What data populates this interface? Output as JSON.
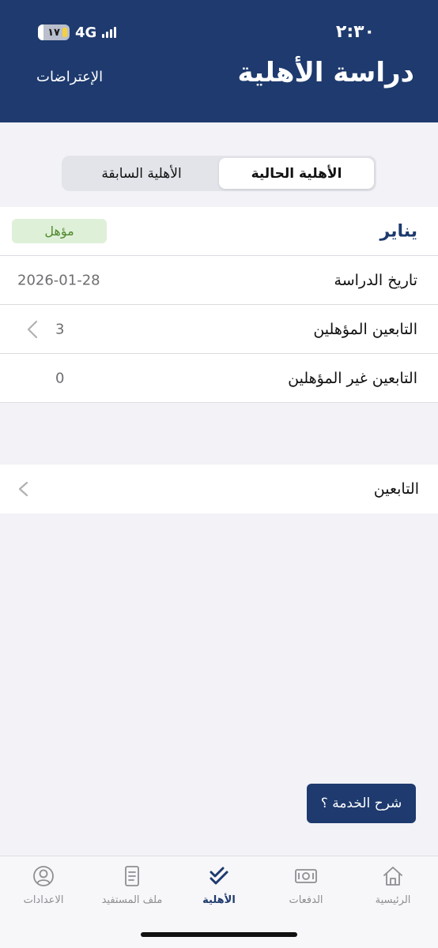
{
  "status_bar": {
    "time": "٢:٣٠",
    "network": "4G",
    "battery_label": "١٧",
    "battery_level": 0.17
  },
  "header": {
    "title": "دراسة الأهلية",
    "objections_link": "الإعتراضات"
  },
  "segmented": {
    "current": "الأهلية الحالية",
    "previous": "الأهلية السابقة"
  },
  "eligibility": {
    "month": "يناير",
    "status_badge": "مؤهل",
    "rows": [
      {
        "label": "تاريخ الدراسة",
        "value": "2026-01-28"
      },
      {
        "label": "التابعين المؤهلين",
        "value": "3"
      },
      {
        "label": "التابعين غير المؤهلين",
        "value": "0"
      }
    ]
  },
  "dependents": {
    "label": "التابعين"
  },
  "service_button": {
    "label": "شرح الخدمة ؟"
  },
  "tabs": [
    {
      "id": "home",
      "label": "الرئيسية",
      "icon": "house-icon"
    },
    {
      "id": "payments",
      "label": "الدفعات",
      "icon": "banknote-icon"
    },
    {
      "id": "eligibility",
      "label": "الأهلية",
      "icon": "double-check-icon",
      "active": true
    },
    {
      "id": "profile",
      "label": "ملف المستفيد",
      "icon": "document-icon"
    },
    {
      "id": "settings",
      "label": "الاعدادات",
      "icon": "user-circle-icon"
    }
  ],
  "colors": {
    "primary": "#1e3a6e",
    "background": "#f2f2f7",
    "badge_bg": "#dff0d8",
    "badge_text": "#4f8a2e",
    "inactive_tab": "#8e8e93"
  }
}
